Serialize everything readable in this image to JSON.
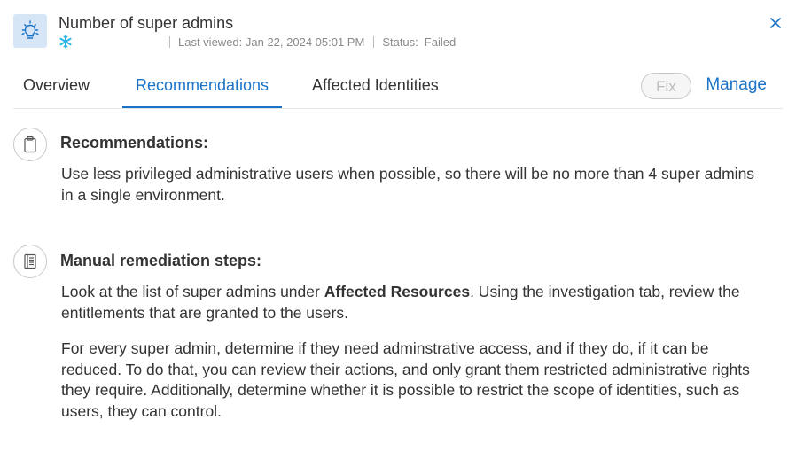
{
  "header": {
    "title": "Number of super admins",
    "last_viewed": "Last viewed: Jan 22, 2024 05:01 PM",
    "status_label": "Status:",
    "status_value": "Failed"
  },
  "tabs": [
    {
      "label": "Overview"
    },
    {
      "label": "Recommendations",
      "active": true
    },
    {
      "label": "Affected Identities"
    }
  ],
  "actions": {
    "fix_label": "Fix",
    "manage_label": "Manage"
  },
  "recommendations": {
    "title": "Recommendations:",
    "body": "Use less privileged administrative users when possible, so there will be no more than 4 super admins in a single environment."
  },
  "remediation": {
    "title": "Manual remediation steps:",
    "p1_before": "Look at the list of super admins under ",
    "p1_bold": "Affected Resources",
    "p1_after": ". Using the investigation tab, review the entitlements that are granted to the users.",
    "p2": "For every super admin, determine if they need adminstrative access, and if they do, if it can be reduced. To do that, you can review their actions, and only grant them restricted administrative rights they require. Additionally, determine whether it is possible to restrict the scope of identities, such as users, they can control."
  },
  "colors": {
    "accent": "#1a73c8",
    "icon_bg": "#d6e6f7",
    "snowflake": "#29b5e8"
  },
  "icons": {
    "header": "lightbulb-icon",
    "source": "snowflake-icon",
    "close": "close-icon",
    "recommendations": "clipboard-icon",
    "remediation": "book-icon"
  }
}
